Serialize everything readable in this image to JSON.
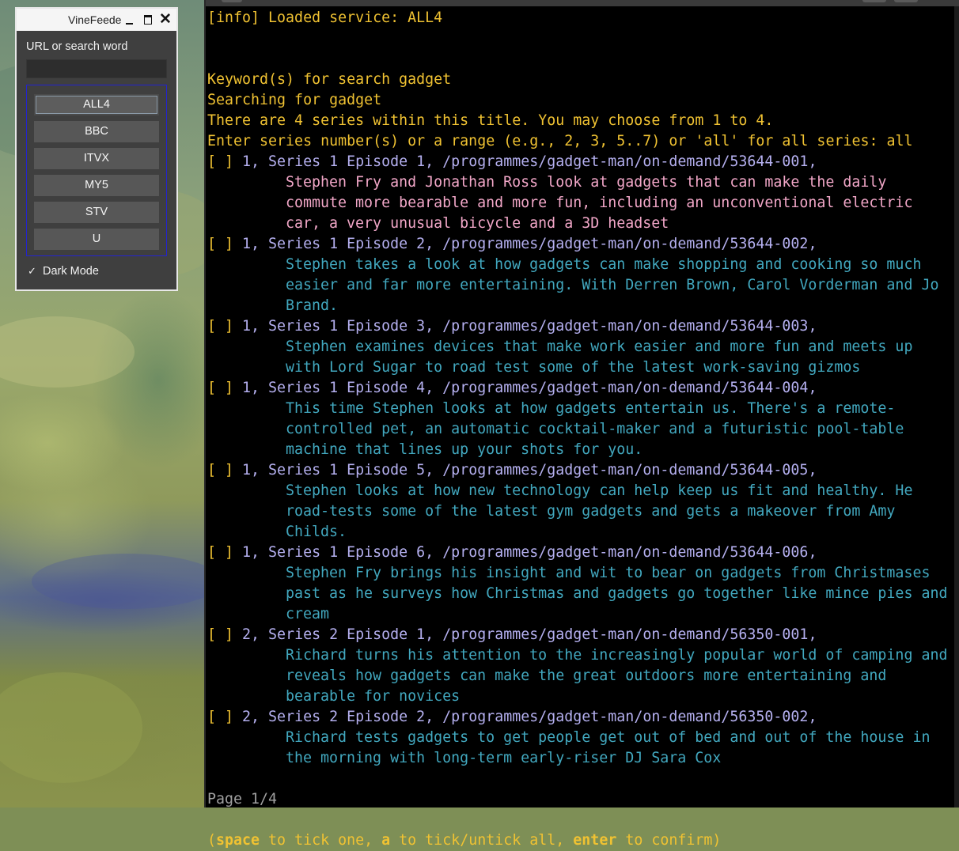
{
  "app": {
    "title": "VineFeeder",
    "url_label": "URL or search word",
    "url_value": "",
    "services": [
      "ALL4",
      "BBC",
      "ITVX",
      "MY5",
      "STV",
      "U"
    ],
    "active_service": "ALL4",
    "dark_mode_label": "Dark Mode",
    "dark_mode_checked": true
  },
  "terminal": {
    "lines": [
      {
        "text": "[info] Loaded service: ALL4",
        "color": "yellow"
      },
      {
        "text": "",
        "color": "yellow"
      },
      {
        "text": "",
        "color": "yellow"
      },
      {
        "text": "Keyword(s) for search gadget",
        "color": "yellow"
      },
      {
        "text": "Searching for gadget",
        "color": "yellow"
      },
      {
        "text": "There are 4 series within this title. You may choose from 1 to 4.",
        "color": "yellow"
      },
      {
        "text": "Enter series number(s) or a range (e.g., 2, 3, 5..7) or 'all' for all series: all",
        "color": "yellow"
      }
    ],
    "episodes": [
      {
        "tick": "[ ]",
        "header": " 1, Series 1 Episode 1, /programmes/gadget-man/on-demand/53644-001,",
        "desc": "Stephen Fry and Jonathan Ross look at gadgets that can make the daily commute more bearable and more fun, including an unconventional electric car, a very unusual bicycle and a 3D headset",
        "desc_color": "pink"
      },
      {
        "tick": "[ ]",
        "header": " 1, Series 1 Episode 2, /programmes/gadget-man/on-demand/53644-002,",
        "desc": "Stephen takes a look at how gadgets can make shopping and cooking so much easier and far more entertaining. With Derren Brown, Carol Vorderman and Jo Brand.",
        "desc_color": "cyan"
      },
      {
        "tick": "[ ]",
        "header": " 1, Series 1 Episode 3, /programmes/gadget-man/on-demand/53644-003,",
        "desc": "Stephen examines devices that make work easier and more fun and meets up with Lord Sugar to road test some of the latest work-saving gizmos",
        "desc_color": "cyan"
      },
      {
        "tick": "[ ]",
        "header": " 1, Series 1 Episode 4, /programmes/gadget-man/on-demand/53644-004,",
        "desc": "This time Stephen looks at how gadgets entertain us. There's a remote-controlled pet, an automatic cocktail-maker and a futuristic pool-table machine that lines up your shots for you.",
        "desc_color": "cyan"
      },
      {
        "tick": "[ ]",
        "header": " 1, Series 1 Episode 5, /programmes/gadget-man/on-demand/53644-005,",
        "desc": "Stephen looks at how new technology can help keep us fit and healthy. He road-tests some of the latest gym gadgets and gets a makeover from Amy Childs.",
        "desc_color": "cyan"
      },
      {
        "tick": "[ ]",
        "header": " 1, Series 1 Episode 6, /programmes/gadget-man/on-demand/53644-006,",
        "desc": "Stephen Fry brings his insight and wit to bear on gadgets from Christmases past as he surveys how Christmas and gadgets go together like mince pies and cream",
        "desc_color": "cyan"
      },
      {
        "tick": "[ ]",
        "header": " 2, Series 2 Episode 1, /programmes/gadget-man/on-demand/56350-001,",
        "desc": "Richard turns his attention to the increasingly popular world of camping and reveals how gadgets can make the great outdoors more entertaining and bearable for novices",
        "desc_color": "cyan"
      },
      {
        "tick": "[ ]",
        "header": " 2, Series 2 Episode 2, /programmes/gadget-man/on-demand/56350-002,",
        "desc": "Richard tests gadgets to get people get out of bed and out of the house in the morning with long-term early-riser DJ Sara Cox",
        "desc_color": "cyan"
      }
    ],
    "page": "Page 1/4",
    "help": {
      "open": "(",
      "key1": "space",
      "t1": " to tick one, ",
      "key2": "a",
      "t2": " to tick/untick all, ",
      "key3": "enter",
      "t3": " to confirm)"
    }
  },
  "colors": {
    "yellow": "#f0c232",
    "pink": "#f2a7c8",
    "cyan": "#42a8bf",
    "lavender": "#b5b0f0",
    "gray": "#a0a0a0"
  }
}
